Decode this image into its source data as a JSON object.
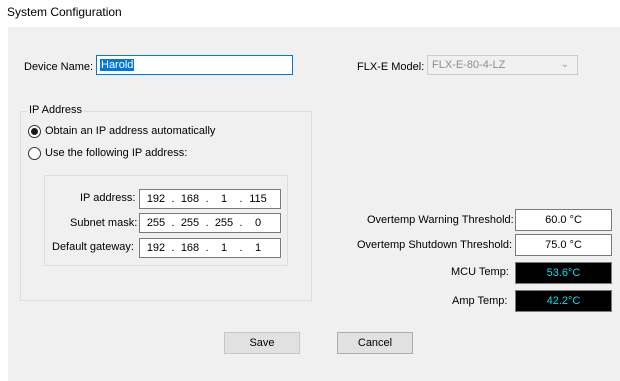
{
  "window": {
    "title": "System Configuration"
  },
  "device": {
    "name_label": "Device Name:",
    "name_value": "Harold"
  },
  "model": {
    "label": "FLX-E Model:",
    "value": "FLX-E-80-4-LZ"
  },
  "ip_group": {
    "title": "IP Address",
    "option_auto": "Obtain an IP address automatically",
    "option_manual": "Use the following IP address:",
    "selected": "auto",
    "ip_label": "IP address:",
    "ip": [
      "192",
      "168",
      "1",
      "115"
    ],
    "subnet_label": "Subnet mask:",
    "subnet": [
      "255",
      "255",
      "255",
      "0"
    ],
    "gateway_label": "Default gateway:",
    "gateway": [
      "192",
      "168",
      "1",
      "1"
    ]
  },
  "thresholds": {
    "warning_label": "Overtemp Warning Threshold:",
    "warning_value": "60.0 °C",
    "shutdown_label": "Overtemp Shutdown Threshold:",
    "shutdown_value": "75.0 °C",
    "mcu_label": "MCU Temp:",
    "mcu_value": "53.6°C",
    "amp_label": "Amp Temp:",
    "amp_value": "42.2°C"
  },
  "buttons": {
    "save": "Save",
    "cancel": "Cancel"
  },
  "colors": {
    "accent": "#0078d7",
    "readout_text": "#00e0f0",
    "panel_bg": "#f0f0f0"
  }
}
